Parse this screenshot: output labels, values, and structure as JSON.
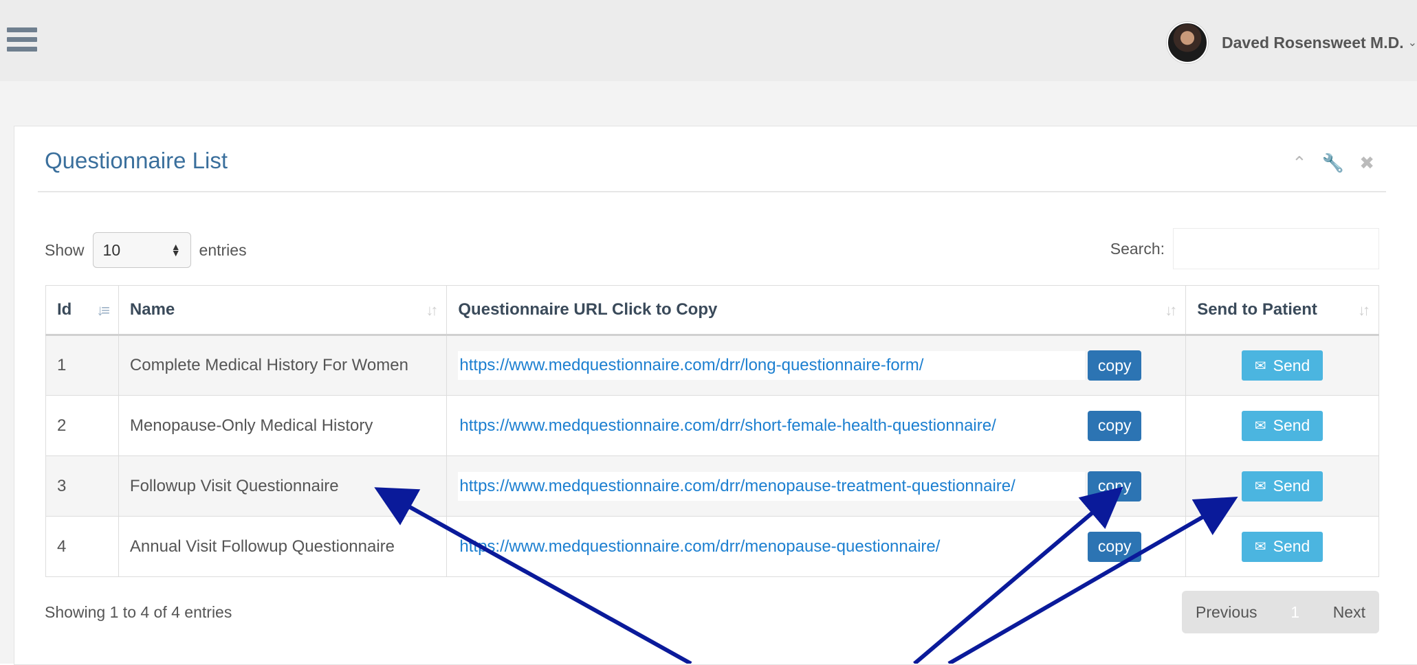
{
  "header": {
    "user_name": "Daved Rosensweet M.D.",
    "user_caret": "⌄"
  },
  "panel": {
    "title": "Questionnaire List",
    "tools": [
      "chevron-up-icon",
      "wrench-icon",
      "close-icon"
    ]
  },
  "length_control": {
    "show_label": "Show",
    "selected": "10",
    "entries_label": "entries"
  },
  "search": {
    "label": "Search:",
    "value": ""
  },
  "table": {
    "columns": [
      "Id",
      "Name",
      "Questionnaire URL Click to Copy",
      "Send to Patient"
    ],
    "rows": [
      {
        "id": "1",
        "name": "Complete Medical History For Women",
        "url": "https://www.medquestionnaire.com/drr/long-questionnaire-form/",
        "copy": "copy",
        "send": "Send"
      },
      {
        "id": "2",
        "name": "Menopause-Only Medical History",
        "url": "https://www.medquestionnaire.com/drr/short-female-health-questionnaire/",
        "copy": "copy",
        "send": "Send"
      },
      {
        "id": "3",
        "name": "Followup Visit Questionnaire",
        "url": "https://www.medquestionnaire.com/drr/menopause-treatment-questionnaire/",
        "copy": "copy",
        "send": "Send"
      },
      {
        "id": "4",
        "name": "Annual Visit Followup Questionnaire",
        "url": "https://www.medquestionnaire.com/drr/menopause-questionnaire/",
        "copy": "copy",
        "send": "Send"
      }
    ]
  },
  "footer": {
    "info": "Showing 1 to 4 of 4 entries",
    "previous": "Previous",
    "page": "1",
    "next": "Next"
  },
  "colors": {
    "accent": "#2c74b3",
    "send": "#4bb5e0",
    "link": "#1c7fd0",
    "annotation_arrow": "#0a1a9a"
  }
}
